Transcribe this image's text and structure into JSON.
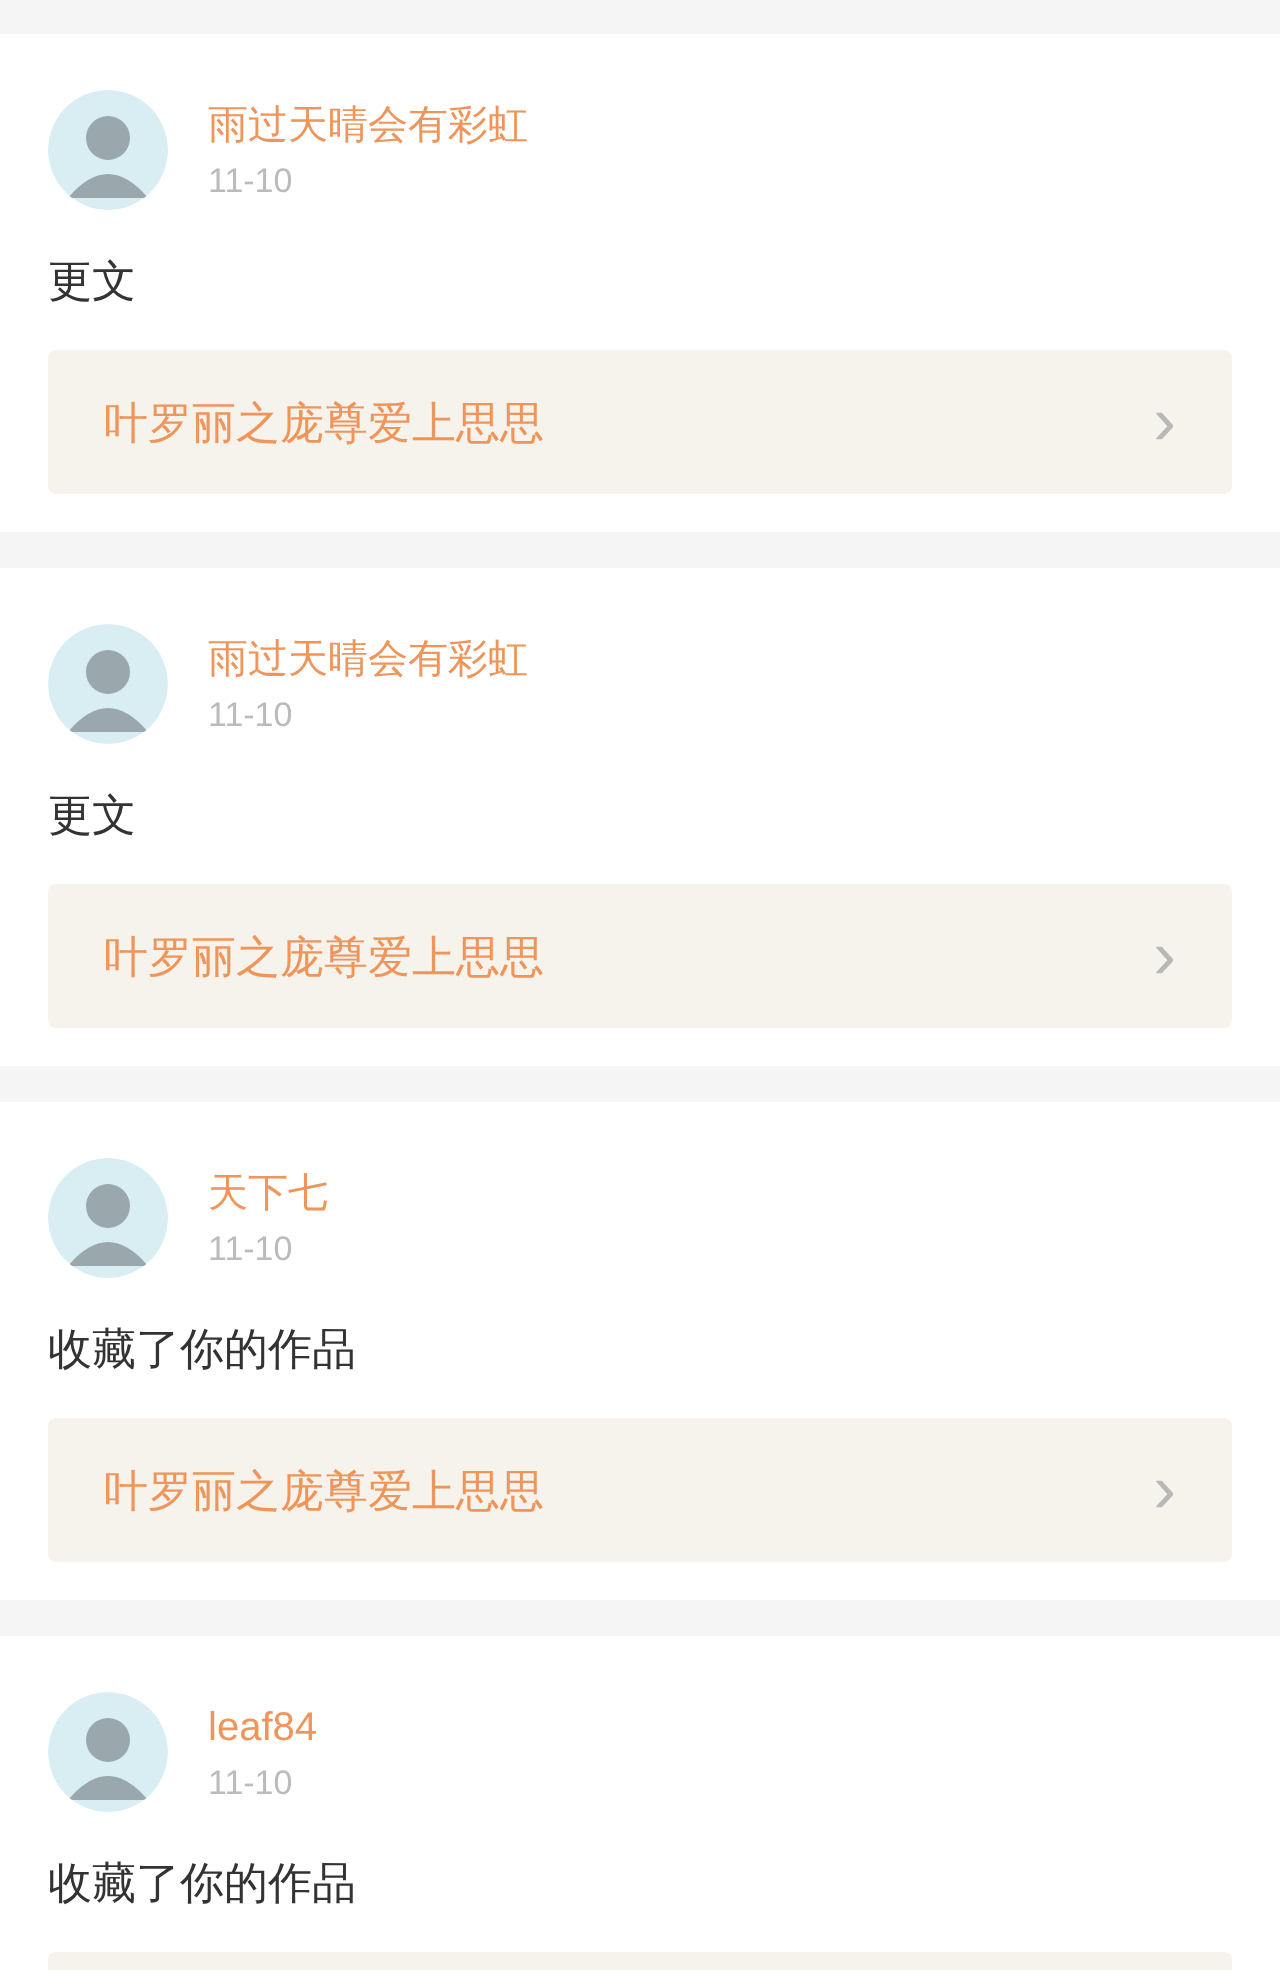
{
  "feed": [
    {
      "user": "雨过天晴会有彩虹",
      "date": "11-10",
      "text": "更文",
      "link": {
        "title": "叶罗丽之庞尊爱上思思",
        "chevron": "›"
      }
    },
    {
      "user": "雨过天晴会有彩虹",
      "date": "11-10",
      "text": "更文",
      "link": {
        "title": "叶罗丽之庞尊爱上思思",
        "chevron": "›"
      }
    },
    {
      "user": "天下七",
      "date": "11-10",
      "text": "收藏了你的作品",
      "link": {
        "title": "叶罗丽之庞尊爱上思思",
        "chevron": "›"
      }
    },
    {
      "user": "leaf84",
      "date": "11-10",
      "text": "收藏了你的作品",
      "link_box": true
    }
  ]
}
